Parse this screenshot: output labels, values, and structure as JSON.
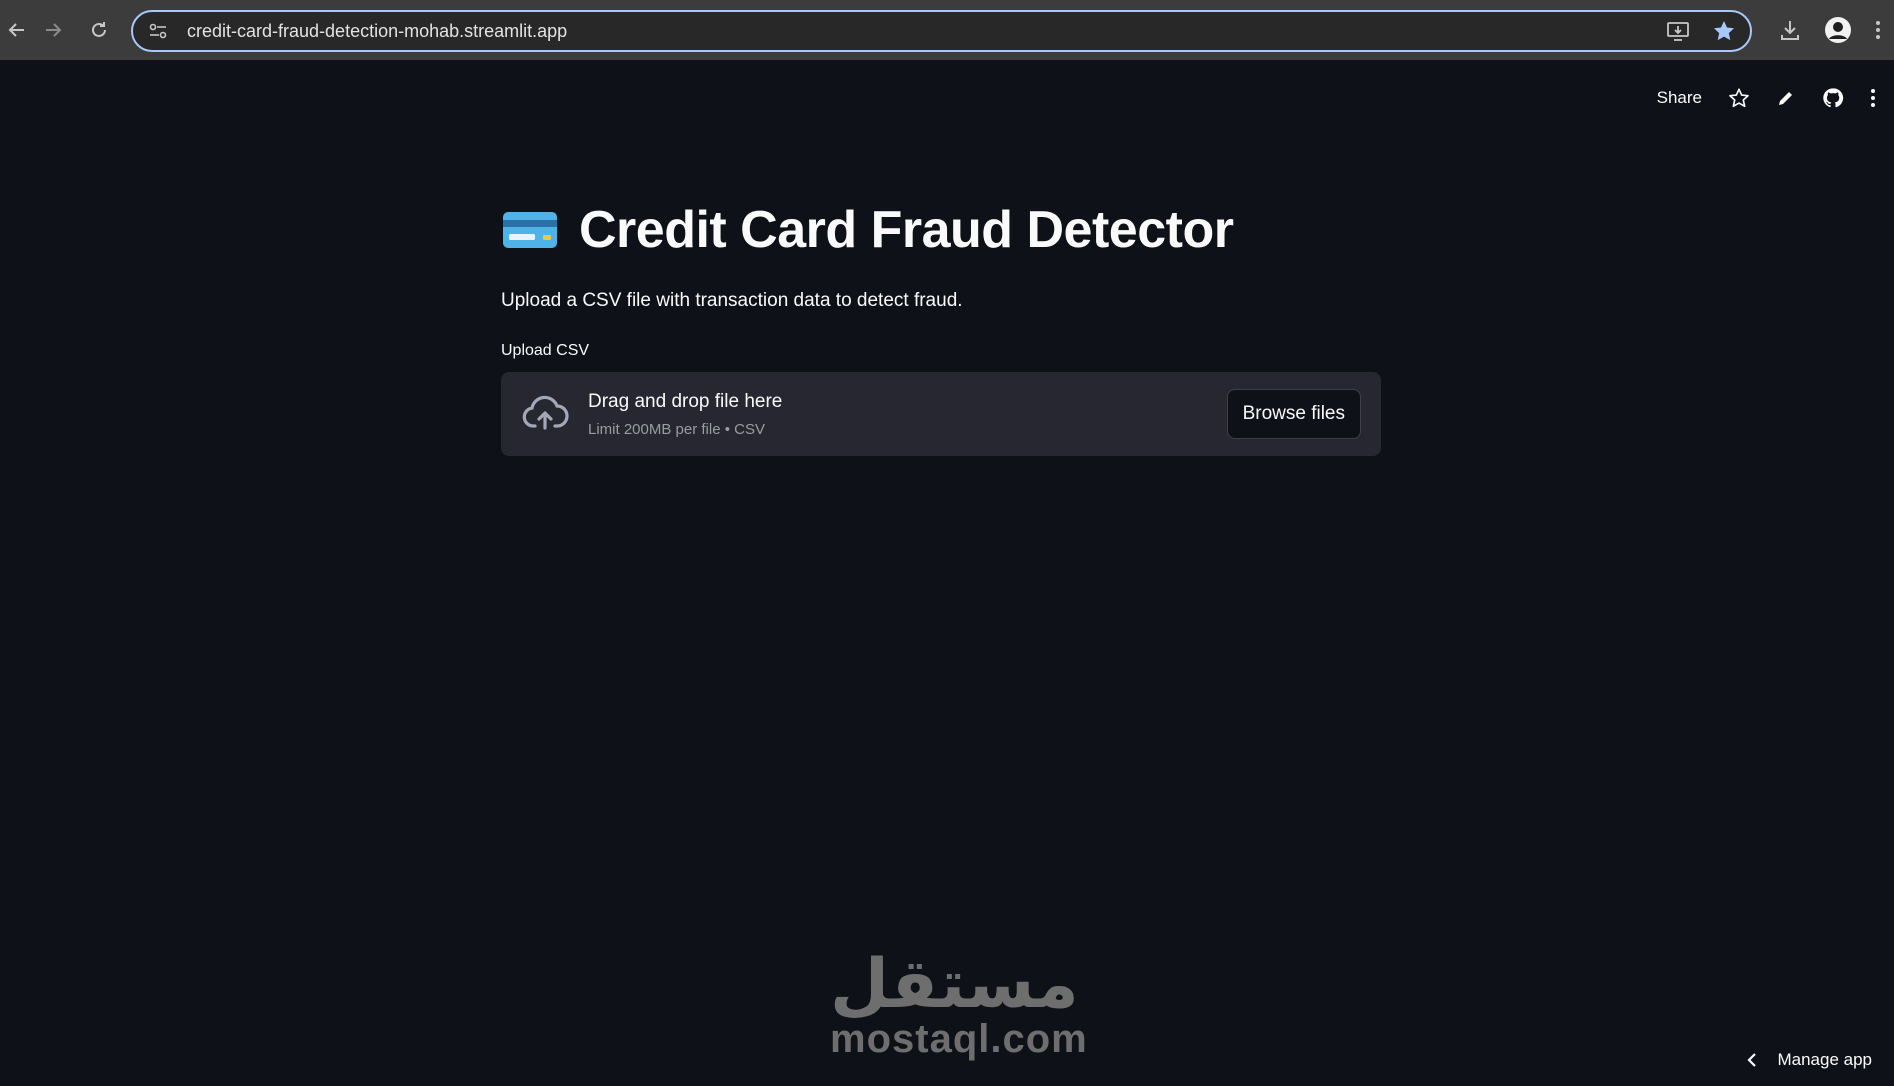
{
  "browser": {
    "url": "credit-card-fraud-detection-mohab.streamlit.app",
    "icons": [
      "back-icon",
      "forward-icon",
      "reload-icon",
      "site-settings-icon",
      "install-app-icon",
      "bookmark-star-icon",
      "download-icon",
      "profile-avatar-icon",
      "chrome-menu-icon"
    ],
    "accent_color": "#a8c7fa"
  },
  "toolbar": {
    "share_label": "Share",
    "icons": [
      "star-icon",
      "edit-icon",
      "github-icon",
      "more-vert-icon"
    ]
  },
  "app": {
    "title_emoji": "credit-card-icon",
    "title": "Credit Card Fraud Detector",
    "subtitle": "Upload a CSV file with transaction data to detect fraud.",
    "uploader": {
      "label": "Upload CSV",
      "drop_text": "Drag and drop file here",
      "limit_text": "Limit 200MB per file • CSV",
      "browse_label": "Browse files"
    }
  },
  "watermark": {
    "arabic": "مستقل",
    "latin": "mostaql.com"
  },
  "footer": {
    "manage_app_label": "Manage app"
  },
  "colors": {
    "background": "#0e1117",
    "dropzone": "#262730",
    "text": "#fafafa"
  }
}
